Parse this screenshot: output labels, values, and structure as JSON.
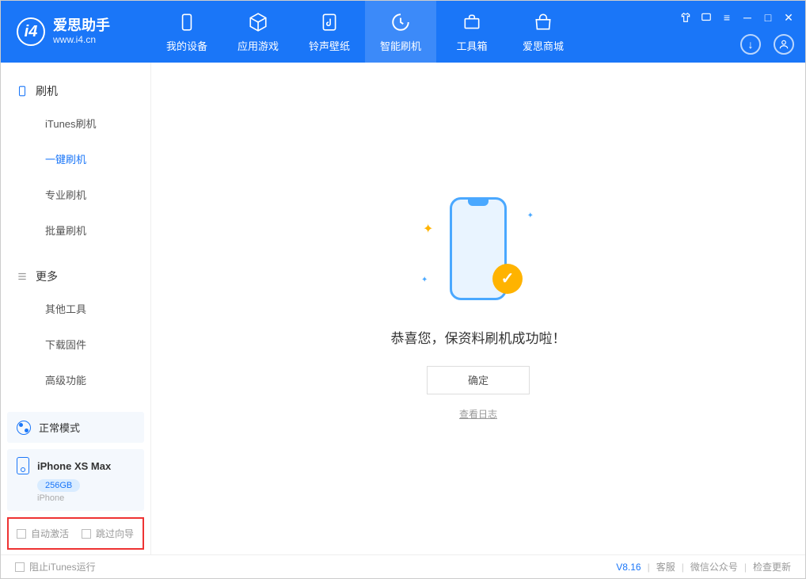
{
  "app": {
    "logo_title": "爱思助手",
    "logo_sub": "www.i4.cn"
  },
  "nav": {
    "items": [
      {
        "label": "我的设备",
        "icon": "device"
      },
      {
        "label": "应用游戏",
        "icon": "cube"
      },
      {
        "label": "铃声壁纸",
        "icon": "music"
      },
      {
        "label": "智能刷机",
        "icon": "refresh"
      },
      {
        "label": "工具箱",
        "icon": "toolbox"
      },
      {
        "label": "爱思商城",
        "icon": "shop"
      }
    ]
  },
  "sidebar": {
    "section1": {
      "title": "刷机",
      "items": [
        "iTunes刷机",
        "一键刷机",
        "专业刷机",
        "批量刷机"
      ]
    },
    "section2": {
      "title": "更多",
      "items": [
        "其他工具",
        "下载固件",
        "高级功能"
      ]
    },
    "status": {
      "label": "正常模式"
    },
    "device": {
      "name": "iPhone XS Max",
      "storage": "256GB",
      "type": "iPhone"
    },
    "checks": {
      "auto_activate": "自动激活",
      "skip_wizard": "跳过向导"
    }
  },
  "main": {
    "success_msg": "恭喜您，保资料刷机成功啦！",
    "ok_btn": "确定",
    "log_link": "查看日志"
  },
  "footer": {
    "stop_itunes": "阻止iTunes运行",
    "version": "V8.16",
    "links": [
      "客服",
      "微信公众号",
      "检查更新"
    ]
  }
}
